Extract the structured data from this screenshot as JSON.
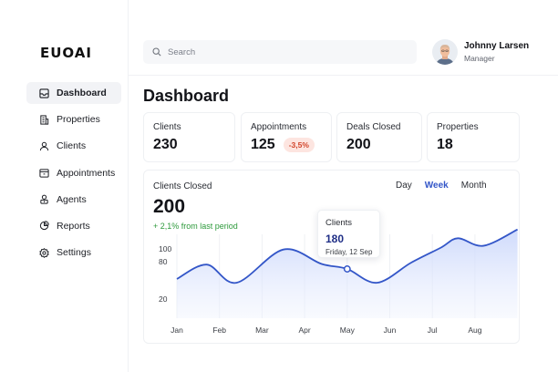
{
  "brand": {
    "logo": "EUOAI"
  },
  "sidebar": {
    "items": [
      {
        "label": "Dashboard",
        "icon": "dashboard-icon",
        "active": true
      },
      {
        "label": "Properties",
        "icon": "building-icon",
        "active": false
      },
      {
        "label": "Clients",
        "icon": "user-icon",
        "active": false
      },
      {
        "label": "Appointments",
        "icon": "calendar-icon",
        "active": false
      },
      {
        "label": "Agents",
        "icon": "agent-icon",
        "active": false
      },
      {
        "label": "Reports",
        "icon": "pie-chart-icon",
        "active": false
      },
      {
        "label": "Settings",
        "icon": "gear-icon",
        "active": false
      }
    ]
  },
  "search": {
    "placeholder": "Search",
    "value": ""
  },
  "user": {
    "name": "Johnny Larsen",
    "role": "Manager"
  },
  "page": {
    "title": "Dashboard"
  },
  "stats": [
    {
      "label": "Clients",
      "value": "230",
      "badge": ""
    },
    {
      "label": "Appointments",
      "value": "125",
      "badge": "-3,5%"
    },
    {
      "label": "Deals Closed",
      "value": "200",
      "badge": ""
    },
    {
      "label": "Properties",
      "value": "18",
      "badge": ""
    }
  ],
  "colors": {
    "accent": "#3356c8",
    "negative": "#d2452b",
    "negative_bg": "#fde5e0",
    "positive": "#2e9a3c"
  },
  "chart": {
    "title": "Clients Closed",
    "value": "200",
    "change": "+ 2,1% from last period",
    "periods": [
      "Day",
      "Week",
      "Month"
    ],
    "active_period": "Week",
    "tooltip": {
      "label": "Clients",
      "value": "180",
      "date": "Friday, 12 Sep"
    }
  },
  "chart_data": {
    "type": "area",
    "title": "",
    "xlabel": "",
    "ylabel": "",
    "categories": [
      "Jan",
      "Feb",
      "Mar",
      "Apr",
      "May",
      "Jun",
      "Jul",
      "Aug"
    ],
    "yticks": [
      20,
      80,
      100
    ],
    "ylim": [
      0,
      140
    ],
    "grid": "vertical",
    "series": [
      {
        "points": [
          [
            0,
            52
          ],
          [
            0.7,
            75
          ],
          [
            1.4,
            46
          ],
          [
            2.5,
            99
          ],
          [
            3.4,
            76
          ],
          [
            4.0,
            68
          ],
          [
            4.7,
            46
          ],
          [
            5.5,
            78
          ],
          [
            6.2,
            102
          ],
          [
            6.6,
            117
          ],
          [
            7.2,
            105
          ],
          [
            8.0,
            131
          ]
        ]
      }
    ],
    "highlight": {
      "x": 4.0,
      "y": 68
    }
  }
}
